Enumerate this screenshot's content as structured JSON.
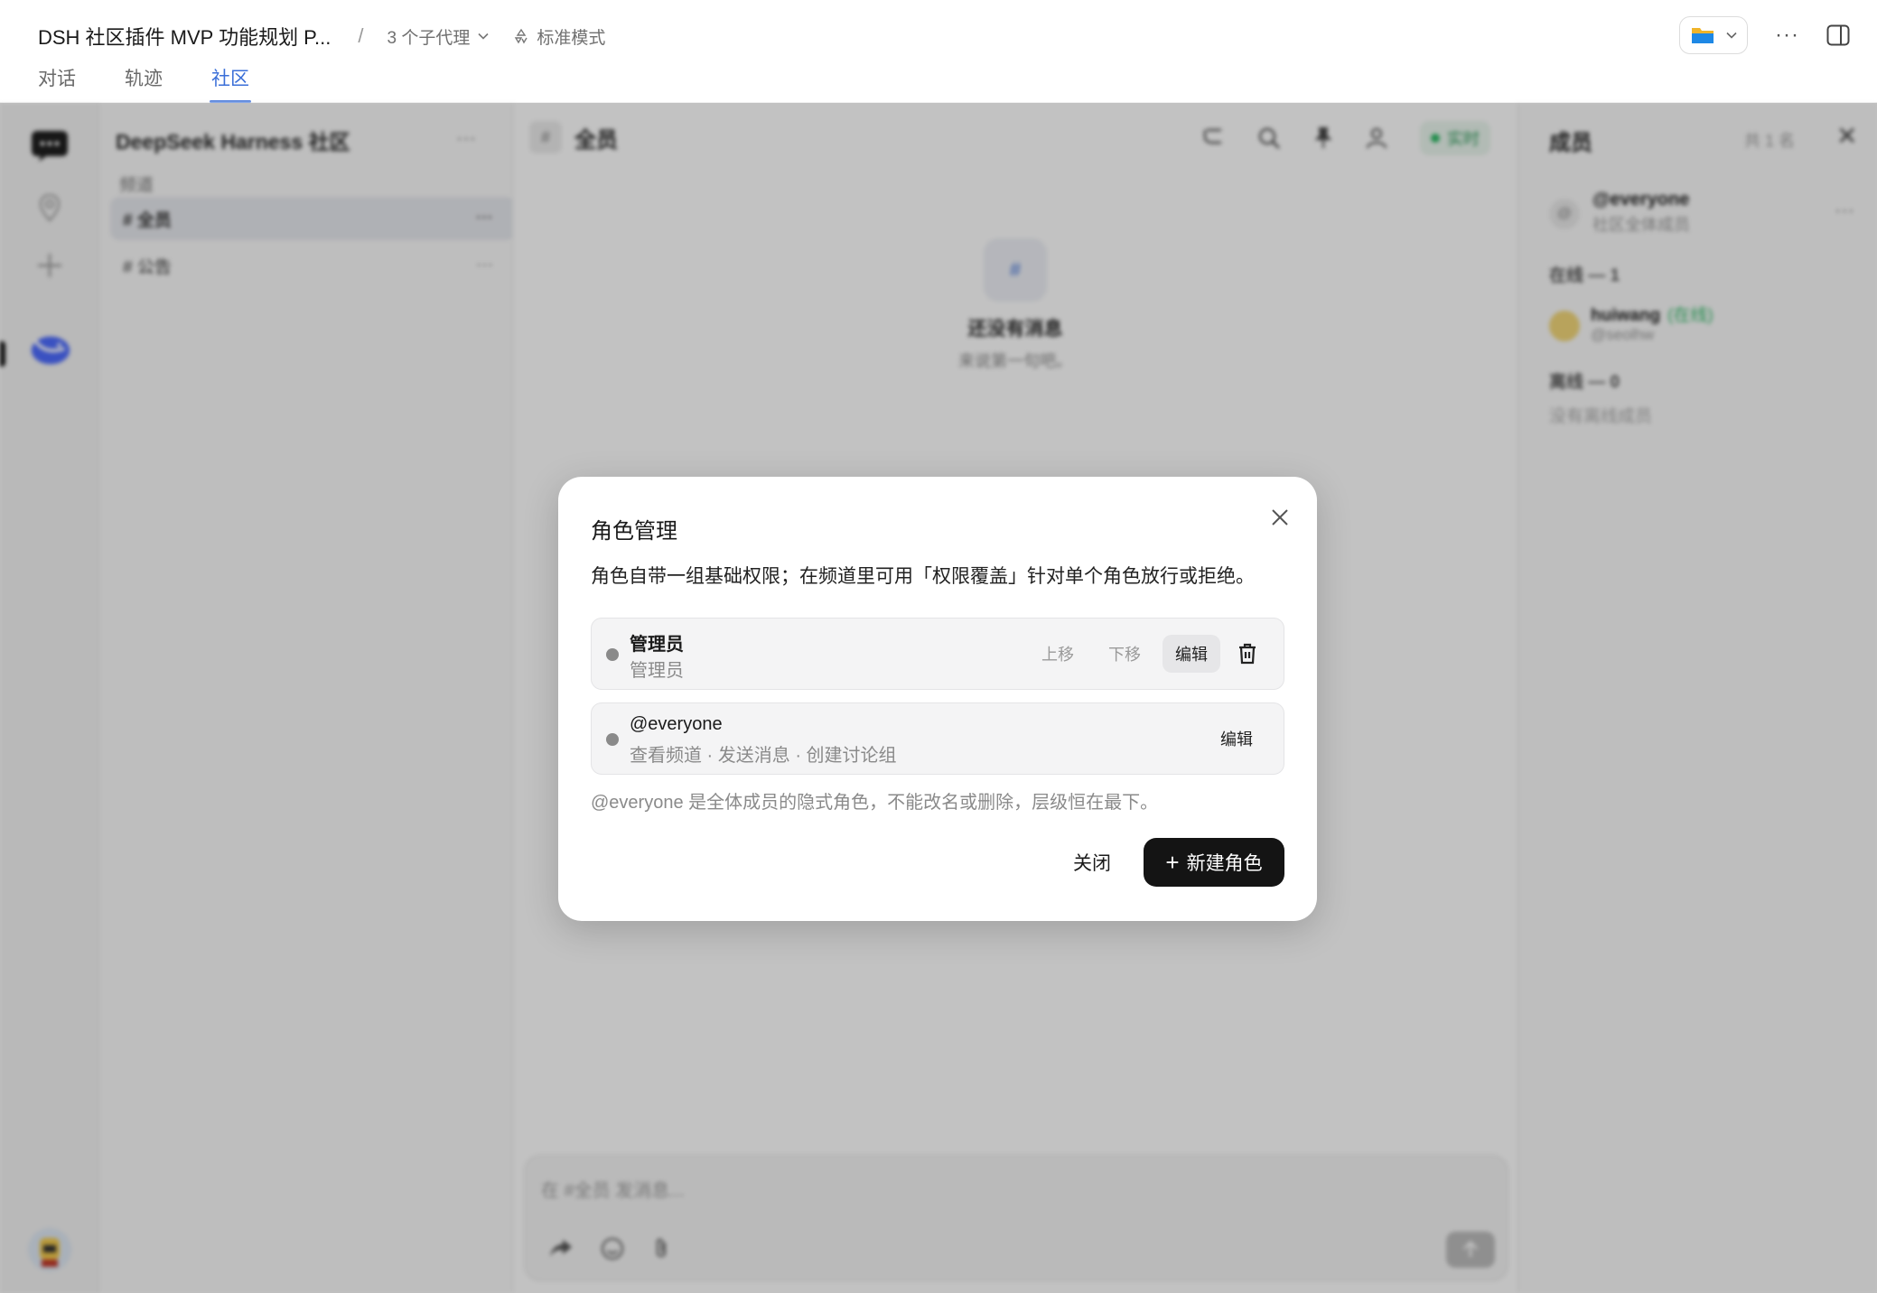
{
  "header": {
    "doc_title": "DSH 社区插件 MVP 功能规划 P...",
    "separator": "/",
    "agents_label": "3 个子代理",
    "mode_label": "标准模式",
    "more_label": "···",
    "tabs": [
      {
        "label": "对话"
      },
      {
        "label": "轨迹"
      },
      {
        "label": "社区"
      }
    ],
    "active_tab": "社区"
  },
  "background": {
    "community_name": "DeepSeek Harness 社区",
    "channels_section": "频道",
    "channels": [
      {
        "label": "# 全员",
        "active": true
      },
      {
        "label": "# 公告",
        "active": false
      }
    ],
    "main": {
      "channel_title": "全员",
      "live_label": "实时",
      "empty_title": "还没有消息",
      "empty_sub": "来说第一句吧。",
      "composer_placeholder": "在 #全员 发消息..."
    },
    "members": {
      "title": "成员",
      "count": "共 1 名",
      "role_name": "@everyone",
      "role_desc": "社区全体成员",
      "online_label": "在线 — 1",
      "user_name": "huiwang",
      "user_status": "(在线)",
      "user_handle": "@seolhw",
      "offline_label": "离线 — 0",
      "offline_empty": "没有离线成员"
    }
  },
  "modal": {
    "title": "角色管理",
    "description": "角色自带一组基础权限；在频道里可用「权限覆盖」针对单个角色放行或拒绝。",
    "roles": [
      {
        "name": "管理员",
        "sub": "管理员",
        "move_up": "上移",
        "move_down": "下移",
        "edit": "编辑"
      },
      {
        "name": "@everyone",
        "sub": "查看频道 · 发送消息 · 创建讨论组",
        "edit": "编辑"
      }
    ],
    "note": "@everyone 是全体成员的隐式角色，不能改名或删除，层级恒在最下。",
    "close_label": "关闭",
    "new_role_label": "新建角色",
    "new_role_icon": "+"
  },
  "colors": {
    "accent": "#3b6fd8",
    "primary_button": "#141414",
    "online": "#2fba66"
  }
}
